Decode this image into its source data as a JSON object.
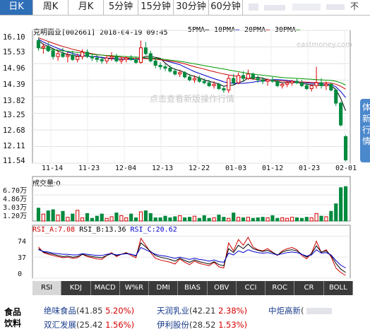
{
  "tabs": [
    {
      "label": "日K",
      "active": true
    },
    {
      "label": "周K",
      "active": false
    },
    {
      "label": "月K",
      "active": false
    },
    {
      "label": "5分钟",
      "active": false
    },
    {
      "label": "15分钟",
      "active": false
    },
    {
      "label": "30分钟",
      "active": false
    },
    {
      "label": "60分钟",
      "active": false
    }
  ],
  "close_label": "不",
  "chart_title": "克明面业[002661] 2018-04-19 09:45",
  "ma_legend": [
    {
      "label": "5PMA",
      "color": "#000000"
    },
    {
      "label": "10PMA",
      "color": "#0000cc"
    },
    {
      "label": "20PMA",
      "color": "#cc0000"
    },
    {
      "label": "30PMA",
      "color": "#009900"
    }
  ],
  "watermark": "点击查看新版操作行情",
  "watermark_site": "eastmoney.com",
  "side_button": [
    "体",
    "新",
    "行",
    "情"
  ],
  "chart_data": {
    "type": "candlestick",
    "price_ticks": [
      "16.10",
      "15.53",
      "14.96",
      "14.39",
      "13.82",
      "13.25",
      "12.68",
      "12.11",
      "11.54"
    ],
    "ylim": [
      11.54,
      16.1
    ],
    "date_ticks": [
      "11-14",
      "11-23",
      "12-04",
      "12-13",
      "12-22",
      "01-03",
      "01-12",
      "01-23",
      "02-01"
    ],
    "candles": [
      {
        "o": 15.75,
        "h": 15.85,
        "l": 15.4,
        "c": 15.5
      },
      {
        "o": 15.5,
        "h": 15.65,
        "l": 15.3,
        "c": 15.55
      },
      {
        "o": 15.55,
        "h": 15.7,
        "l": 15.35,
        "c": 15.4
      },
      {
        "o": 15.4,
        "h": 15.45,
        "l": 15.1,
        "c": 15.2
      },
      {
        "o": 15.2,
        "h": 15.4,
        "l": 15.05,
        "c": 15.3
      },
      {
        "o": 15.3,
        "h": 15.5,
        "l": 15.15,
        "c": 15.2
      },
      {
        "o": 15.2,
        "h": 15.35,
        "l": 15.0,
        "c": 15.25
      },
      {
        "o": 15.25,
        "h": 15.4,
        "l": 15.05,
        "c": 15.1
      },
      {
        "o": 15.1,
        "h": 15.3,
        "l": 15.0,
        "c": 15.2
      },
      {
        "o": 15.2,
        "h": 15.45,
        "l": 15.1,
        "c": 15.35
      },
      {
        "o": 15.35,
        "h": 15.45,
        "l": 15.15,
        "c": 15.2
      },
      {
        "o": 15.2,
        "h": 15.3,
        "l": 15.05,
        "c": 15.15
      },
      {
        "o": 15.15,
        "h": 15.25,
        "l": 15.0,
        "c": 15.1
      },
      {
        "o": 15.1,
        "h": 15.2,
        "l": 14.95,
        "c": 15.05
      },
      {
        "o": 15.05,
        "h": 15.25,
        "l": 14.95,
        "c": 15.15
      },
      {
        "o": 15.15,
        "h": 15.35,
        "l": 15.05,
        "c": 15.2
      },
      {
        "o": 15.2,
        "h": 15.3,
        "l": 15.0,
        "c": 15.05
      },
      {
        "o": 15.05,
        "h": 15.2,
        "l": 14.95,
        "c": 15.1
      },
      {
        "o": 15.1,
        "h": 15.2,
        "l": 15.0,
        "c": 15.15
      },
      {
        "o": 15.15,
        "h": 15.25,
        "l": 15.05,
        "c": 15.1
      },
      {
        "o": 15.1,
        "h": 15.2,
        "l": 14.95,
        "c": 15.0
      },
      {
        "o": 15.0,
        "h": 15.75,
        "l": 14.95,
        "c": 15.5
      },
      {
        "o": 15.5,
        "h": 15.7,
        "l": 15.25,
        "c": 15.3
      },
      {
        "o": 15.3,
        "h": 15.4,
        "l": 15.0,
        "c": 15.05
      },
      {
        "o": 15.05,
        "h": 15.15,
        "l": 14.8,
        "c": 14.9
      },
      {
        "o": 14.9,
        "h": 15.0,
        "l": 14.75,
        "c": 14.85
      },
      {
        "o": 14.85,
        "h": 14.95,
        "l": 14.7,
        "c": 14.8
      },
      {
        "o": 14.8,
        "h": 14.9,
        "l": 14.65,
        "c": 14.7
      },
      {
        "o": 14.7,
        "h": 14.8,
        "l": 14.55,
        "c": 14.6
      },
      {
        "o": 14.6,
        "h": 14.75,
        "l": 14.5,
        "c": 14.65
      },
      {
        "o": 14.65,
        "h": 14.7,
        "l": 14.45,
        "c": 14.5
      },
      {
        "o": 14.5,
        "h": 14.6,
        "l": 14.35,
        "c": 14.4
      },
      {
        "o": 14.4,
        "h": 14.55,
        "l": 14.3,
        "c": 14.45
      },
      {
        "o": 14.45,
        "h": 14.55,
        "l": 14.3,
        "c": 14.35
      },
      {
        "o": 14.35,
        "h": 14.45,
        "l": 14.25,
        "c": 14.3
      },
      {
        "o": 14.3,
        "h": 14.4,
        "l": 14.15,
        "c": 14.2
      },
      {
        "o": 14.2,
        "h": 14.35,
        "l": 14.1,
        "c": 14.25
      },
      {
        "o": 14.25,
        "h": 14.3,
        "l": 14.05,
        "c": 14.1
      },
      {
        "o": 14.1,
        "h": 14.2,
        "l": 13.95,
        "c": 14.05
      },
      {
        "o": 14.05,
        "h": 14.55,
        "l": 13.95,
        "c": 14.45
      },
      {
        "o": 14.45,
        "h": 14.6,
        "l": 14.2,
        "c": 14.3
      },
      {
        "o": 14.3,
        "h": 14.65,
        "l": 14.25,
        "c": 14.55
      },
      {
        "o": 14.55,
        "h": 14.7,
        "l": 14.35,
        "c": 14.45
      },
      {
        "o": 14.45,
        "h": 14.75,
        "l": 14.4,
        "c": 14.6
      },
      {
        "o": 14.6,
        "h": 14.65,
        "l": 14.4,
        "c": 14.45
      },
      {
        "o": 14.45,
        "h": 14.55,
        "l": 14.3,
        "c": 14.4
      },
      {
        "o": 14.4,
        "h": 14.5,
        "l": 14.25,
        "c": 14.35
      },
      {
        "o": 14.35,
        "h": 14.45,
        "l": 14.2,
        "c": 14.4
      },
      {
        "o": 14.4,
        "h": 14.5,
        "l": 14.3,
        "c": 14.35
      },
      {
        "o": 14.35,
        "h": 14.4,
        "l": 14.15,
        "c": 14.2
      },
      {
        "o": 14.2,
        "h": 14.3,
        "l": 14.1,
        "c": 14.25
      },
      {
        "o": 14.25,
        "h": 14.35,
        "l": 14.15,
        "c": 14.3
      },
      {
        "o": 14.3,
        "h": 14.4,
        "l": 14.2,
        "c": 14.35
      },
      {
        "o": 14.35,
        "h": 14.45,
        "l": 14.25,
        "c": 14.3
      },
      {
        "o": 14.3,
        "h": 14.4,
        "l": 14.15,
        "c": 14.2
      },
      {
        "o": 14.2,
        "h": 14.3,
        "l": 14.05,
        "c": 14.1
      },
      {
        "o": 14.1,
        "h": 14.25,
        "l": 14.0,
        "c": 14.2
      },
      {
        "o": 14.2,
        "h": 14.85,
        "l": 14.1,
        "c": 14.3
      },
      {
        "o": 14.3,
        "h": 14.45,
        "l": 14.1,
        "c": 14.2
      },
      {
        "o": 14.2,
        "h": 14.35,
        "l": 14.05,
        "c": 14.25
      },
      {
        "o": 14.25,
        "h": 14.3,
        "l": 14.0,
        "c": 14.05
      },
      {
        "o": 14.05,
        "h": 14.1,
        "l": 13.5,
        "c": 13.6
      },
      {
        "o": 13.6,
        "h": 13.65,
        "l": 12.8,
        "c": 12.85
      },
      {
        "o": 12.45,
        "h": 12.5,
        "l": 11.6,
        "c": 11.65
      }
    ],
    "ma": [
      {
        "name": "5PMA",
        "color": "#000000",
        "values": [
          15.75,
          15.62,
          15.55,
          15.47,
          15.39,
          15.33,
          15.27,
          15.25,
          15.21,
          15.22,
          15.22,
          15.2,
          15.2,
          15.16,
          15.13,
          15.13,
          15.11,
          15.11,
          15.12,
          15.13,
          15.08,
          15.15,
          15.21,
          15.21,
          15.17,
          15.14,
          14.98,
          14.84,
          14.76,
          14.72,
          14.65,
          14.57,
          14.52,
          14.47,
          14.4,
          14.35,
          14.31,
          14.26,
          14.18,
          14.21,
          14.22,
          14.31,
          14.35,
          14.47,
          14.47,
          14.49,
          14.45,
          14.41,
          14.38,
          14.34,
          14.3,
          14.31,
          14.3,
          14.31,
          14.28,
          14.25,
          14.23,
          14.23,
          14.2,
          14.21,
          14.2,
          14.07,
          13.76,
          13.34
        ]
      },
      {
        "name": "10PMA",
        "color": "#0000cc",
        "values": [
          15.8,
          15.7,
          15.62,
          15.55,
          15.48,
          15.42,
          15.36,
          15.31,
          15.26,
          15.24,
          15.22,
          15.2,
          15.19,
          15.17,
          15.15,
          15.14,
          15.12,
          15.11,
          15.11,
          15.1,
          15.09,
          15.12,
          15.15,
          15.15,
          15.13,
          15.1,
          15.06,
          15.01,
          14.97,
          14.92,
          14.84,
          14.76,
          14.68,
          14.62,
          14.56,
          14.5,
          14.44,
          14.39,
          14.33,
          14.3,
          14.28,
          14.28,
          14.28,
          14.3,
          14.32,
          14.35,
          14.36,
          14.38,
          14.41,
          14.41,
          14.4,
          14.38,
          14.36,
          14.34,
          14.32,
          14.3,
          14.28,
          14.27,
          14.26,
          14.25,
          14.24,
          14.16,
          14.0,
          13.79
        ]
      },
      {
        "name": "20PMA",
        "color": "#cc0000",
        "values": [
          15.85,
          15.78,
          15.72,
          15.66,
          15.6,
          15.55,
          15.5,
          15.45,
          15.41,
          15.37,
          15.33,
          15.3,
          15.27,
          15.25,
          15.23,
          15.21,
          15.19,
          15.17,
          15.16,
          15.15,
          15.14,
          15.13,
          15.13,
          15.12,
          15.11,
          15.09,
          15.07,
          15.05,
          15.02,
          14.99,
          14.95,
          14.9,
          14.85,
          14.81,
          14.77,
          14.72,
          14.68,
          14.64,
          14.6,
          14.57,
          14.54,
          14.51,
          14.48,
          14.45,
          14.43,
          14.41,
          14.4,
          14.39,
          14.38,
          14.37,
          14.36,
          14.35,
          14.34,
          14.33,
          14.33,
          14.32,
          14.31,
          14.31,
          14.3,
          14.3,
          14.29,
          14.25,
          14.18,
          14.08
        ]
      },
      {
        "name": "30PMA",
        "color": "#009900",
        "values": [
          15.5,
          15.48,
          15.46,
          15.44,
          15.42,
          15.4,
          15.38,
          15.36,
          15.34,
          15.32,
          15.3,
          15.28,
          15.26,
          15.25,
          15.24,
          15.23,
          15.22,
          15.21,
          15.2,
          15.19,
          15.18,
          15.17,
          15.16,
          15.15,
          15.14,
          15.12,
          15.1,
          15.08,
          15.06,
          15.04,
          15.01,
          14.98,
          14.95,
          14.92,
          14.89,
          14.86,
          14.83,
          14.8,
          14.77,
          14.74,
          14.71,
          14.68,
          14.65,
          14.62,
          14.6,
          14.58,
          14.56,
          14.54,
          14.52,
          14.5,
          14.48,
          14.47,
          14.46,
          14.45,
          14.44,
          14.43,
          14.42,
          14.41,
          14.4,
          14.39,
          14.38,
          14.35,
          14.3,
          14.22
        ]
      }
    ],
    "volume_label": "成交量:0",
    "volume_ticks": [
      "6.70万",
      "4.86万",
      "3.03万",
      "1.20万"
    ],
    "volume_max": 6.7,
    "volumes": [
      2.4,
      1.3,
      1.9,
      2.1,
      1.1,
      1.8,
      0.7,
      1.3,
      2.0,
      0.6,
      1.4,
      0.5,
      0.9,
      1.3,
      0.5,
      0.8,
      1.5,
      1.0,
      0.6,
      1.3,
      0.6,
      1.7,
      1.9,
      1.4,
      0.6,
      0.6,
      0.9,
      0.6,
      0.8,
      1.0,
      0.6,
      0.7,
      0.9,
      0.5,
      1.0,
      0.5,
      0.6,
      1.1,
      0.7,
      0.5,
      1.5,
      0.7,
      0.6,
      0.7,
      0.5,
      0.6,
      0.7,
      0.6,
      1.0,
      0.5,
      0.6,
      0.5,
      0.7,
      0.6,
      0.5,
      0.7,
      0.6,
      1.4,
      0.9,
      0.8,
      1.8,
      3.2,
      6.2,
      6.4
    ],
    "rsi_label": {
      "a": "RSI_A:7.08",
      "b": "RSI_B:13.36",
      "c": "RSI_C:20.62"
    },
    "rsi_ticks": [
      "74",
      "37",
      "0"
    ],
    "rsi_ylim": [
      0,
      100
    ],
    "rsi": [
      {
        "name": "RSI_A",
        "color": "#cc0000",
        "values": [
          55,
          45,
          42,
          40,
          38,
          36,
          37,
          35,
          36,
          42,
          38,
          36,
          34,
          33,
          40,
          45,
          38,
          42,
          45,
          40,
          36,
          70,
          58,
          45,
          35,
          32,
          30,
          28,
          25,
          34,
          28,
          24,
          30,
          26,
          24,
          22,
          28,
          20,
          18,
          62,
          48,
          68,
          58,
          72,
          55,
          50,
          48,
          52,
          46,
          40,
          48,
          52,
          54,
          50,
          40,
          34,
          44,
          65,
          45,
          50,
          38,
          18,
          10,
          5
        ]
      },
      {
        "name": "RSI_B",
        "color": "#000000",
        "values": [
          52,
          46,
          44,
          42,
          40,
          38,
          39,
          37,
          38,
          42,
          40,
          38,
          37,
          36,
          40,
          43,
          40,
          42,
          44,
          42,
          39,
          62,
          55,
          47,
          40,
          37,
          35,
          33,
          30,
          35,
          31,
          28,
          32,
          29,
          27,
          25,
          29,
          24,
          22,
          52,
          45,
          58,
          52,
          60,
          52,
          49,
          47,
          49,
          45,
          41,
          46,
          49,
          50,
          48,
          42,
          37,
          43,
          57,
          46,
          48,
          40,
          26,
          16,
          10
        ]
      },
      {
        "name": "RSI_C",
        "color": "#0000cc",
        "values": [
          50,
          47,
          46,
          44,
          43,
          42,
          42,
          41,
          41,
          43,
          42,
          41,
          40,
          40,
          42,
          43,
          41,
          42,
          43,
          42,
          40,
          54,
          50,
          46,
          42,
          40,
          39,
          37,
          35,
          37,
          35,
          33,
          35,
          33,
          32,
          30,
          32,
          29,
          28,
          44,
          41,
          48,
          45,
          50,
          47,
          45,
          44,
          45,
          43,
          41,
          43,
          45,
          46,
          45,
          42,
          39,
          41,
          50,
          44,
          45,
          41,
          31,
          23,
          18
        ]
      }
    ]
  },
  "indicators": [
    {
      "label": "RSI",
      "active": true
    },
    {
      "label": "KDJ",
      "active": false
    },
    {
      "label": "MACD",
      "active": false
    },
    {
      "label": "W%R",
      "active": false
    },
    {
      "label": "DMI",
      "active": false
    },
    {
      "label": "BIAS",
      "active": false
    },
    {
      "label": "OBV",
      "active": false
    },
    {
      "label": "CCI",
      "active": false
    },
    {
      "label": "ROC",
      "active": false
    },
    {
      "label": "CR",
      "active": false
    },
    {
      "label": "BOLL",
      "active": false
    }
  ],
  "bottom": {
    "category": "食品饮料",
    "stocks": [
      {
        "name": "绝味食品",
        "price": "(41.85",
        "change": "5.20%)"
      },
      {
        "name": "天润乳业",
        "price": "(42.21",
        "change": "2.38%)"
      },
      {
        "name": "中炬高新",
        "price": "(",
        "change": ""
      },
      {
        "name": "双汇发展",
        "price": "(25.42",
        "change": "1.56%)"
      },
      {
        "name": "伊利股份",
        "price": "(28.52",
        "change": "1.53%)"
      }
    ]
  }
}
